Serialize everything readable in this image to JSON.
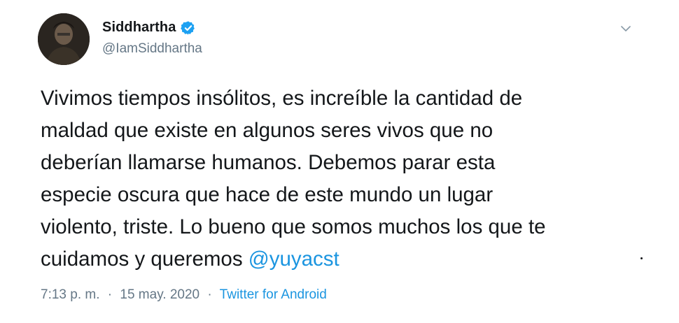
{
  "author": {
    "display_name": "Siddhartha",
    "handle": "@IamSiddhartha",
    "verified": true,
    "avatar_icon": "avatar-photo"
  },
  "tweet": {
    "text_lines": [
      "Vivimos tiempos insólitos, es increíble la cantidad de",
      "maldad que existe en algunos seres vivos que no",
      "deberían llamarse humanos. Debemos parar esta",
      "especie oscura que hace de este mundo un lugar",
      "violento, triste. Lo bueno que somos muchos los que te",
      "cuidamos y queremos "
    ],
    "mention": "@yuyacst",
    "time": "7:13 p. m.",
    "separator": "·",
    "date": "15 may. 2020",
    "source": "Twitter for Android"
  },
  "colors": {
    "text": "#14171a",
    "secondary": "#657786",
    "link": "#1b95e0",
    "verified": "#1da1f2"
  },
  "icons": {
    "verified": "verified-badge-icon",
    "menu": "chevron-down-icon"
  }
}
